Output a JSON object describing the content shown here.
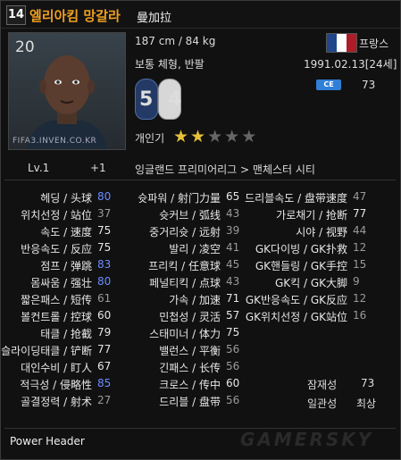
{
  "header": {
    "ovr": "14",
    "name_ko": "엘리아킴 망갈라",
    "name_cn": "曼加拉"
  },
  "photo": {
    "number": "20",
    "watermark": "FIFA3.INVEN.CO.KR"
  },
  "info": {
    "height_weight": "187 cm / 84 kg",
    "body_type": "보통 체형, 반팔",
    "nation": "프랑스",
    "birth": "1991.02.13[24세]",
    "badge": "CE",
    "badge_value": "73",
    "foot_left": "5",
    "foot_right": "4",
    "popularity_label": "개인기",
    "level": "Lv.1",
    "plus": "+1",
    "league_club": "잉글랜드 프리미어리그 > 맨체스터 시티"
  },
  "skill_stars": {
    "filled": 2,
    "total": 5
  },
  "flag_colors": [
    "#21468b",
    "#ffffff",
    "#ae1c28"
  ],
  "stats_col1": [
    {
      "label": "헤딩 / 头球",
      "value": "80",
      "lc": "g",
      "vc": "b"
    },
    {
      "label": "위치선정 / 站位",
      "value": "37",
      "lc": "g",
      "vc": "g"
    },
    {
      "label": "속도 / 速度",
      "value": "75",
      "lc": "g",
      "vc": "w"
    },
    {
      "label": "반응속도 / 反应",
      "value": "75",
      "lc": "g",
      "vc": "w"
    },
    {
      "label": "점프 / 弹跳",
      "value": "83",
      "lc": "g",
      "vc": "b"
    },
    {
      "label": "몸싸움 / 强壮",
      "value": "80",
      "lc": "g",
      "vc": "b"
    },
    {
      "label": "짧은패스 / 短传",
      "value": "61",
      "lc": "g",
      "vc": "g"
    },
    {
      "label": "볼컨트롤 / 控球",
      "value": "60",
      "lc": "g",
      "vc": "w"
    },
    {
      "label": "태클 / 抢截",
      "value": "79",
      "lc": "w",
      "vc": "w"
    },
    {
      "label": "슬라이딩태클 / 铲断",
      "value": "77",
      "lc": "w",
      "vc": "w"
    },
    {
      "label": "대인수비 / 盯人",
      "value": "67",
      "lc": "w",
      "vc": "w"
    },
    {
      "label": "적극성 / 侵略性",
      "value": "85",
      "lc": "w",
      "vc": "b"
    },
    {
      "label": "골결정력 / 射术",
      "value": "27",
      "lc": "w",
      "vc": "g"
    }
  ],
  "stats_col2": [
    {
      "label": "슛파워 / 射门力量",
      "value": "65",
      "lc": "r",
      "vc": "w"
    },
    {
      "label": "슛커브 / 弧线",
      "value": "43",
      "lc": "w",
      "vc": "g"
    },
    {
      "label": "중거리슛 / 远射",
      "value": "39",
      "lc": "g",
      "vc": "g"
    },
    {
      "label": "발리 / 凌空",
      "value": "41",
      "lc": "w",
      "vc": "g"
    },
    {
      "label": "프리킥 / 任意球",
      "value": "45",
      "lc": "w",
      "vc": "g"
    },
    {
      "label": "페널티킥 / 点球",
      "value": "43",
      "lc": "w",
      "vc": "g"
    },
    {
      "label": "가속 / 加速",
      "value": "71",
      "lc": "w",
      "vc": "w"
    },
    {
      "label": "민첩성 / 灵活",
      "value": "57",
      "lc": "w",
      "vc": "w"
    },
    {
      "label": "스태미너 / 体力",
      "value": "75",
      "lc": "g",
      "vc": "w"
    },
    {
      "label": "밸런스 / 平衡",
      "value": "56",
      "lc": "w",
      "vc": "g"
    },
    {
      "label": "긴패스 / 长传",
      "value": "56",
      "lc": "g",
      "vc": "g"
    },
    {
      "label": "크로스 / 传中",
      "value": "60",
      "lc": "w",
      "vc": "w"
    },
    {
      "label": "드리블 / 盘带",
      "value": "56",
      "lc": "g",
      "vc": "g"
    }
  ],
  "stats_col3": [
    {
      "label": "드리블속도 / 盘带速度",
      "value": "47",
      "lc": "w",
      "vc": "g"
    },
    {
      "label": "가로채기 / 抢断",
      "value": "77",
      "lc": "w",
      "vc": "w"
    },
    {
      "label": "시야 / 视野",
      "value": "44",
      "lc": "g",
      "vc": "g"
    },
    {
      "label": "GK다이빙 / GK扑救",
      "value": "12",
      "lc": "w",
      "vc": "g"
    },
    {
      "label": "GK핸들링 / GK手控",
      "value": "15",
      "lc": "w",
      "vc": "g"
    },
    {
      "label": "GK킥 / GK大脚",
      "value": "9",
      "lc": "w",
      "vc": "g"
    },
    {
      "label": "GK반응속도 / GK反应",
      "value": "12",
      "lc": "w",
      "vc": "g"
    },
    {
      "label": "GK위치선정 / GK站位",
      "value": "16",
      "lc": "w",
      "vc": "g"
    }
  ],
  "extras": [
    {
      "label": "잠재성",
      "value": "73"
    },
    {
      "label": "일관성",
      "value": "최상"
    }
  ],
  "trait": "Power Header",
  "site_watermark": "GAMERSKY"
}
